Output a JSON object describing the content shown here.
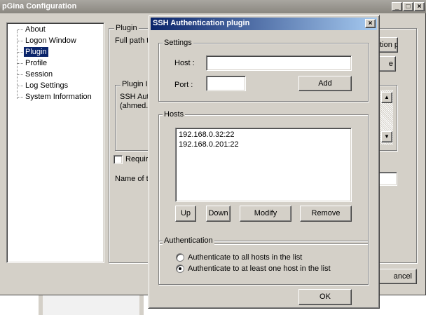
{
  "main": {
    "title": "pGina Configuration",
    "controls": {
      "minimize": "_",
      "maximize": "□",
      "close": "×"
    },
    "tree": [
      "About",
      "Logon Window",
      "Plugin",
      "Profile",
      "Session",
      "Log Settings",
      "System Information"
    ],
    "selected_item": "Plugin",
    "plugin_group": {
      "label": "Plugin",
      "path_label": "Full path t",
      "config_button_partial": "ation p",
      "browse_button_partial": "e"
    },
    "plugin_info": {
      "label": "Plugin In",
      "line1": "SSH Aut",
      "line2": "(ahmed."
    },
    "require_checkbox_label": "Requir",
    "name_label": "Name of tl",
    "cancel_partial": "ancel"
  },
  "dialog": {
    "title": "SSH Authentication plugin",
    "close": "×",
    "settings": {
      "label": "Settings",
      "host_label": "Host  :",
      "host_value": "",
      "port_label": "Port   :",
      "port_value": "",
      "add_button": "Add"
    },
    "hosts": {
      "label": "Hosts",
      "items": [
        "192.168.0.32:22",
        "192.168.0.201:22"
      ],
      "buttons": {
        "up": "Up",
        "down": "Down",
        "modify": "Modify",
        "remove": "Remove"
      }
    },
    "authentication": {
      "label": "Authentication",
      "options": [
        "Authenticate to all hosts in the list",
        "Authenticate to at least one host in the list"
      ],
      "selected_index": 1
    },
    "ok_button": "OK"
  }
}
